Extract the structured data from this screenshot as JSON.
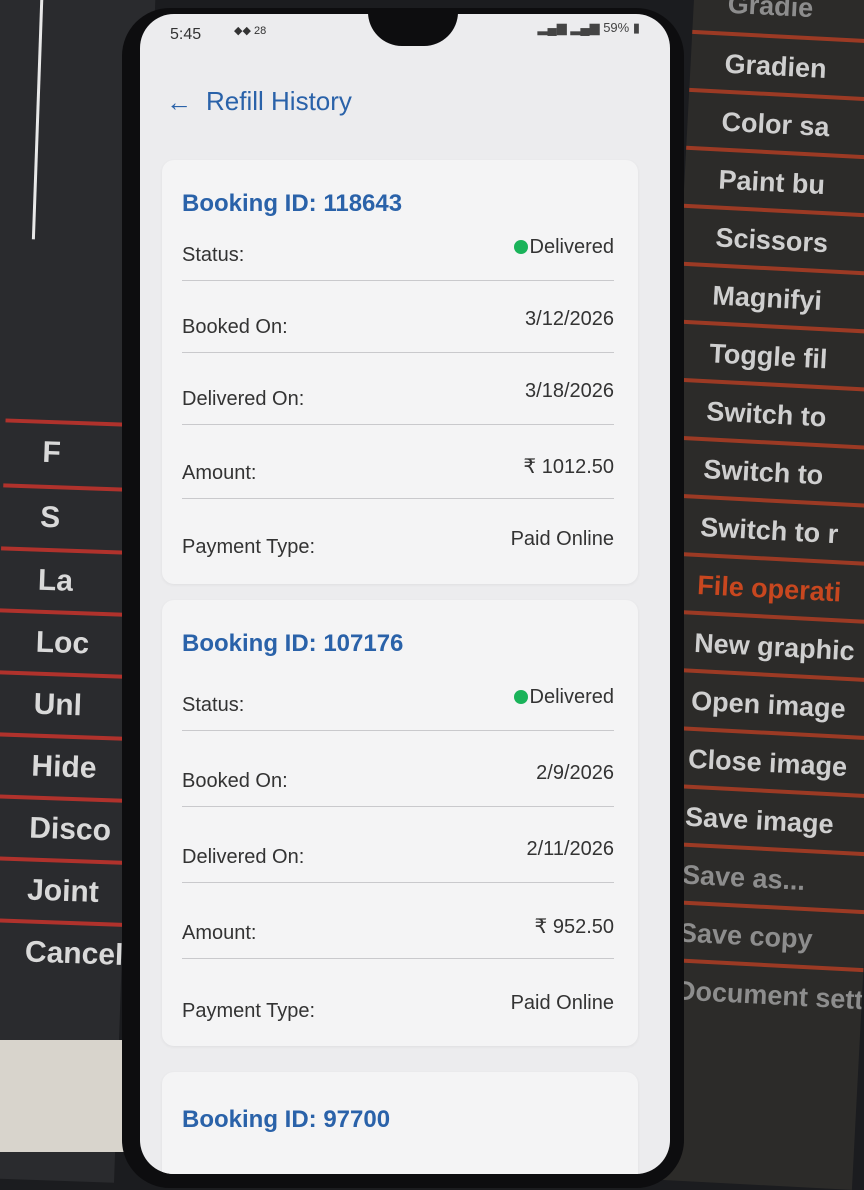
{
  "background": {
    "left_sheet_rows": [
      "F",
      "S",
      "La",
      "Loc",
      "Unl",
      "Hide",
      "Disco",
      "Joint",
      "Cancel"
    ],
    "right_sheet_rows": [
      "Gradie",
      "Gradien",
      "Color sa",
      "Paint bu",
      "Scissors",
      "Magnifyi",
      "Toggle fil",
      "Switch to",
      "Switch to",
      "Switch to r",
      "File operati",
      "New graphic",
      "Open image",
      "Close image",
      "Save image",
      "Save as...",
      "Save copy",
      "Document settin"
    ]
  },
  "status_bar": {
    "time": "5:45",
    "date_badge": "28",
    "battery": "59%"
  },
  "header": {
    "back_icon": "arrow-left-icon",
    "title": "Refill History"
  },
  "labels": {
    "status": "Status:",
    "booked_on": "Booked On:",
    "delivered_on": "Delivered On:",
    "amount": "Amount:",
    "payment_type": "Payment Type:"
  },
  "bookings": [
    {
      "title": "Booking ID: 118643",
      "status": "Delivered",
      "booked_on": "3/12/2026",
      "delivered_on": "3/18/2026",
      "amount": "₹ 1012.50",
      "payment_type": "Paid Online"
    },
    {
      "title": "Booking ID: 107176",
      "status": "Delivered",
      "booked_on": "2/9/2026",
      "delivered_on": "2/11/2026",
      "amount": "₹ 952.50",
      "payment_type": "Paid Online"
    },
    {
      "title": "Booking ID: 97700"
    }
  ],
  "colors": {
    "accent": "#2a62a9",
    "status_green": "#1ab35a"
  }
}
